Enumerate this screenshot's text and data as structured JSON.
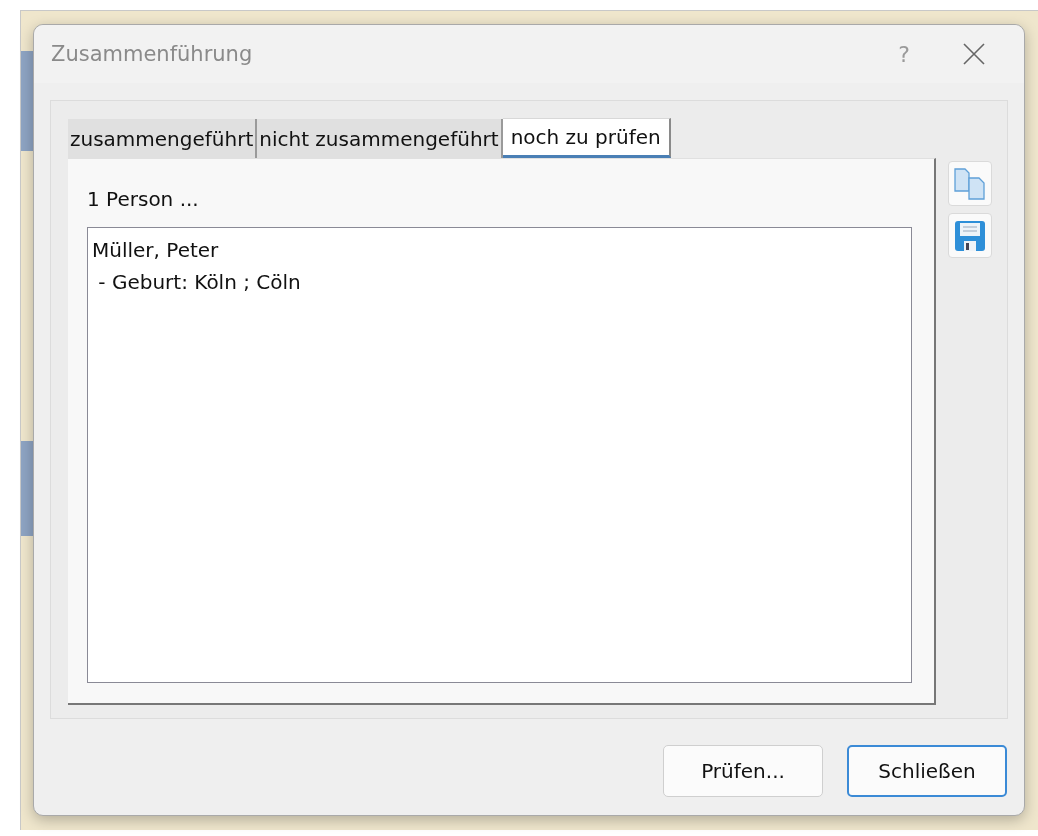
{
  "dialog": {
    "title": "Zusammenführung",
    "help": "?"
  },
  "tabs": [
    {
      "label": "zusammengeführt",
      "selected": false
    },
    {
      "label": "nicht zusammengeführt",
      "selected": false
    },
    {
      "label": "noch zu prüfen",
      "selected": true
    }
  ],
  "summary": "1 Person ...",
  "result_lines": [
    "Müller, Peter",
    " - Geburt: Köln ; Cöln"
  ],
  "buttons": [
    {
      "label": "Prüfen...",
      "default": false
    },
    {
      "label": "Schließen",
      "default": true
    }
  ]
}
